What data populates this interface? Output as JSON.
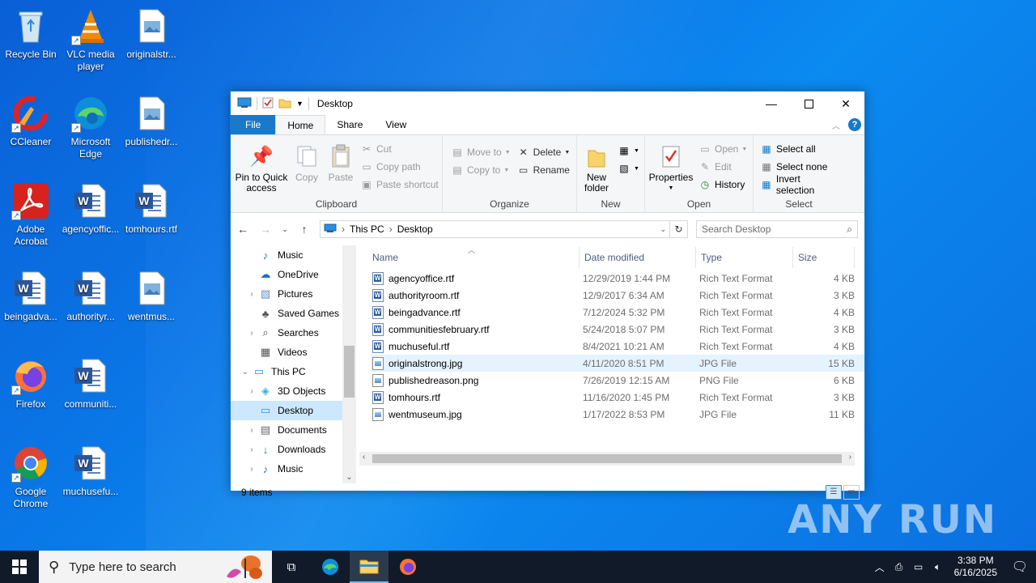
{
  "desktop": {
    "icons": [
      {
        "label": "Recycle Bin"
      },
      {
        "label": "VLC media player"
      },
      {
        "label": "originalstr..."
      },
      {
        "label": "CCleaner"
      },
      {
        "label": "Microsoft Edge"
      },
      {
        "label": "publishedr..."
      },
      {
        "label": "Adobe Acrobat"
      },
      {
        "label": "agencyoffic..."
      },
      {
        "label": "tomhours.rtf"
      },
      {
        "label": "beingadva..."
      },
      {
        "label": "authorityr..."
      },
      {
        "label": "wentmus..."
      },
      {
        "label": "Firefox"
      },
      {
        "label": "communiti..."
      },
      {
        "label": "Google Chrome"
      },
      {
        "label": "muchusefu..."
      }
    ],
    "watermark": "ANY RUN"
  },
  "window": {
    "title": "Desktop",
    "tabs": [
      "File",
      "Home",
      "Share",
      "View"
    ],
    "active_tab": "Home",
    "ribbon": {
      "clipboard": {
        "label": "Clipboard",
        "pin": "Pin to Quick access",
        "copy": "Copy",
        "paste": "Paste",
        "cut": "Cut",
        "copy_path": "Copy path",
        "paste_shortcut": "Paste shortcut"
      },
      "organize": {
        "label": "Organize",
        "move_to": "Move to",
        "copy_to": "Copy to",
        "delete": "Delete",
        "rename": "Rename"
      },
      "new": {
        "label": "New",
        "new_folder": "New folder"
      },
      "open": {
        "label": "Open",
        "properties": "Properties",
        "open": "Open",
        "edit": "Edit",
        "history": "History"
      },
      "select": {
        "label": "Select",
        "select_all": "Select all",
        "select_none": "Select none",
        "invert": "Invert selection"
      }
    },
    "address": {
      "path": [
        "This PC",
        "Desktop"
      ],
      "search_placeholder": "Search Desktop"
    },
    "nav": [
      {
        "label": "Music",
        "indent": 1,
        "chev": ""
      },
      {
        "label": "OneDrive",
        "indent": 1,
        "chev": ""
      },
      {
        "label": "Pictures",
        "indent": 1,
        "chev": "›"
      },
      {
        "label": "Saved Games",
        "indent": 1,
        "chev": ""
      },
      {
        "label": "Searches",
        "indent": 1,
        "chev": "›"
      },
      {
        "label": "Videos",
        "indent": 1,
        "chev": ""
      },
      {
        "label": "This PC",
        "indent": 0,
        "chev": "⌄"
      },
      {
        "label": "3D Objects",
        "indent": 1,
        "chev": "›"
      },
      {
        "label": "Desktop",
        "indent": 1,
        "chev": ""
      },
      {
        "label": "Documents",
        "indent": 1,
        "chev": "›"
      },
      {
        "label": "Downloads",
        "indent": 1,
        "chev": "›"
      },
      {
        "label": "Music",
        "indent": 1,
        "chev": "›"
      }
    ],
    "columns": {
      "name": "Name",
      "date": "Date modified",
      "type": "Type",
      "size": "Size"
    },
    "files": [
      {
        "name": "agencyoffice.rtf",
        "date": "12/29/2019 1:44 PM",
        "type": "Rich Text Format",
        "size": "4 KB",
        "kind": "rtf"
      },
      {
        "name": "authorityroom.rtf",
        "date": "12/9/2017 6:34 AM",
        "type": "Rich Text Format",
        "size": "3 KB",
        "kind": "rtf"
      },
      {
        "name": "beingadvance.rtf",
        "date": "7/12/2024 5:32 PM",
        "type": "Rich Text Format",
        "size": "4 KB",
        "kind": "rtf"
      },
      {
        "name": "communitiesfebruary.rtf",
        "date": "5/24/2018 5:07 PM",
        "type": "Rich Text Format",
        "size": "3 KB",
        "kind": "rtf"
      },
      {
        "name": "muchuseful.rtf",
        "date": "8/4/2021 10:21 AM",
        "type": "Rich Text Format",
        "size": "4 KB",
        "kind": "rtf"
      },
      {
        "name": "originalstrong.jpg",
        "date": "4/11/2020 8:51 PM",
        "type": "JPG File",
        "size": "15 KB",
        "kind": "img"
      },
      {
        "name": "publishedreason.png",
        "date": "7/26/2019 12:15 AM",
        "type": "PNG File",
        "size": "6 KB",
        "kind": "img"
      },
      {
        "name": "tomhours.rtf",
        "date": "11/16/2020 1:45 PM",
        "type": "Rich Text Format",
        "size": "3 KB",
        "kind": "rtf"
      },
      {
        "name": "wentmuseum.jpg",
        "date": "1/17/2022 8:53 PM",
        "type": "JPG File",
        "size": "11 KB",
        "kind": "img"
      }
    ],
    "status": "9 items"
  },
  "taskbar": {
    "search_placeholder": "Type here to search",
    "time": "3:38 PM",
    "date": "6/16/2025"
  }
}
